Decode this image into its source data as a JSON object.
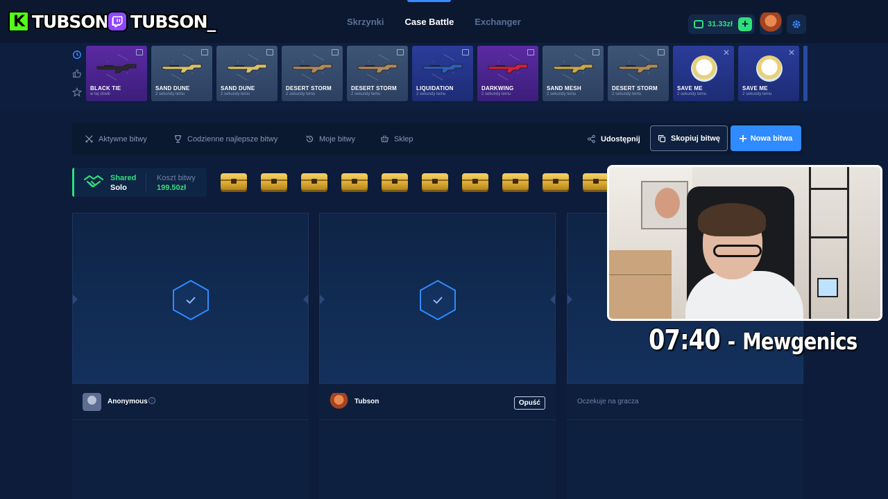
{
  "stream_overlay": {
    "kick_name": "TUBSON",
    "twitch_name": "TUBSON_",
    "timer": "07:40",
    "separator": "-",
    "topic": "Mewgenics"
  },
  "nav": {
    "tabs": [
      {
        "label": "Skrzynki",
        "active": false
      },
      {
        "label": "Case Battle",
        "active": true
      },
      {
        "label": "Exchanger",
        "active": false
      }
    ],
    "balance": "31.33zł",
    "add_label": "+"
  },
  "live_drops": [
    {
      "name": "BLACK TIE",
      "ago": "w tej chwili",
      "style": "purple",
      "kind": "gun",
      "color": "#2a2a2a"
    },
    {
      "name": "SAND DUNE",
      "ago": "2 sekundy temu",
      "style": "grey",
      "kind": "gun",
      "color": "#d9c16a"
    },
    {
      "name": "SAND DUNE",
      "ago": "2 sekundy temu",
      "style": "grey",
      "kind": "gun",
      "color": "#d9c16a"
    },
    {
      "name": "DESERT STORM",
      "ago": "2 sekundy temu",
      "style": "grey",
      "kind": "gun",
      "color": "#b08a5a"
    },
    {
      "name": "DESERT STORM",
      "ago": "2 sekundy temu",
      "style": "grey",
      "kind": "gun",
      "color": "#b08a5a"
    },
    {
      "name": "LIQUIDATION",
      "ago": "2 sekundy temu",
      "style": "blue",
      "kind": "gun",
      "color": "#2d5fbf"
    },
    {
      "name": "DARKWING",
      "ago": "2 sekundy temu",
      "style": "purple",
      "kind": "gun",
      "color": "#d2203a"
    },
    {
      "name": "SAND MESH",
      "ago": "2 sekundy temu",
      "style": "grey",
      "kind": "gun",
      "color": "#c9a84a"
    },
    {
      "name": "DESERT STORM",
      "ago": "2 sekundy temu",
      "style": "grey",
      "kind": "gun",
      "color": "#b08a5a"
    },
    {
      "name": "SAVE ME",
      "ago": "2 sekundy temu",
      "style": "blue",
      "kind": "sticker",
      "color": "#ffffff"
    },
    {
      "name": "SAVE ME",
      "ago": "2 sekundy temu",
      "style": "blue",
      "kind": "sticker",
      "color": "#ffffff"
    }
  ],
  "toolbar": {
    "active_battles": "Aktywne bitwy",
    "daily_best": "Codzienne najlepsze bitwy",
    "my_battles": "Moje bitwy",
    "shop": "Sklep",
    "share": "Udostępnij",
    "copy": "Skopiuj bitwę",
    "new": "Nowa bitwa"
  },
  "battle": {
    "mode_top": "Shared",
    "mode_bottom": "Solo",
    "cost_label": "Koszt bitwy",
    "cost_value": "199.50zł",
    "case_count": 10
  },
  "players": [
    {
      "name": "Anonymous",
      "info": "i"
    },
    {
      "name": "Tubson",
      "leave": "Opuść"
    },
    {
      "waiting": "Oczekuje na gracza"
    }
  ],
  "colors": {
    "accent": "#2f8bff",
    "money": "#2fe07a",
    "background": "#0c1c3a"
  }
}
